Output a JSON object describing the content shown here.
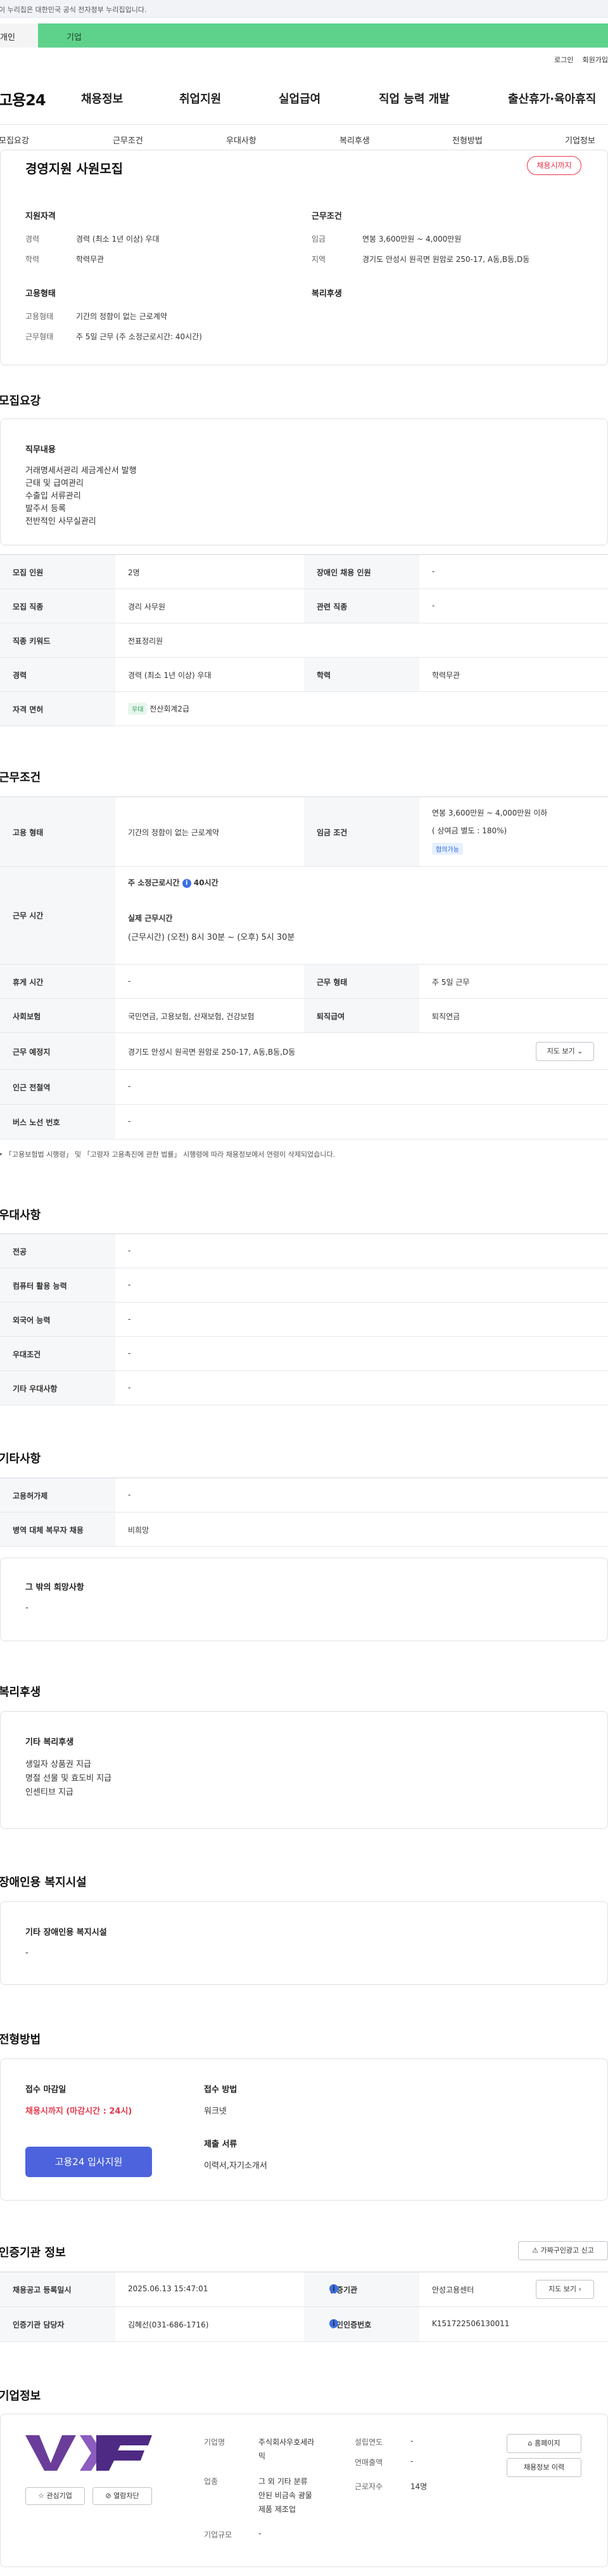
{
  "gov_banner": "이 누리집은 대한민국 공식 전자정부 누리집입니다.",
  "role_tabs": {
    "person": "개인",
    "corp": "기업"
  },
  "util": {
    "login": "로그인",
    "join": "회원가입"
  },
  "gnb": {
    "logo": "고용24",
    "items": [
      "채용정보",
      "취업지원",
      "실업급여",
      "직업 능력 개발",
      "출산휴가·육아휴직"
    ]
  },
  "subnav": [
    "모집요강",
    "근무조건",
    "우대사항",
    "복리후생",
    "전형방법",
    "기업정보"
  ],
  "job": {
    "title": "경영지원 사원모집",
    "status": "채용시까지",
    "summary": {
      "qual_head": "지원자격",
      "career_label": "경력",
      "career_value": "경력 (최소 1년 이상) 우대",
      "edu_label": "학력",
      "edu_value": "학력무관",
      "cond_head": "근무조건",
      "wage_label": "임금",
      "wage_value": "연봉 3,600만원 ~ 4,000만원",
      "region_label": "지역",
      "region_value": "경기도 안성시 원곡면 원암로 250-17, A동,B동,D동",
      "emp_head": "고용형태",
      "emp_label": "고용형태",
      "emp_value": "기간의 정함이 없는 근로계약",
      "work_label": "근무형태",
      "work_value": "주 5일 근무 (주 소정근로시간: 40시간)",
      "welfare_head": "복리후생"
    }
  },
  "recruit": {
    "title": "모집요강",
    "duty_head": "직무내용",
    "duties": [
      "거래명세서관리 세금계산서 발행",
      "근태 및 급여관리",
      "수출입 서류관리",
      "발주서 등록",
      "전반적인 사무실관리"
    ],
    "rows": [
      {
        "l1": "모집 인원",
        "v1": "2명",
        "l2": "장애인 채용 인원",
        "v2": "-"
      },
      {
        "l1": "모집 직종",
        "v1": "경리 사무원",
        "l2": "관련 직종",
        "v2": "-"
      },
      {
        "l1": "직종 키워드",
        "v1": "전표정리원"
      },
      {
        "l1": "경력",
        "v1": "경력 (최소 1년 이상) 우대",
        "l2": "학력",
        "v2": "학력무관"
      },
      {
        "l1": "자격 면허",
        "chip": "우대",
        "v1": "전산회계2급"
      }
    ]
  },
  "conditions": {
    "title": "근무조건",
    "emp_label": "고용 형태",
    "emp_value": "기간의 정함이 없는 근로계약",
    "wage_label": "임금 조건",
    "wage_value": "연봉 3,600만원 ~ 4,000만원 이하",
    "wage_bonus": "( 상여금 별도 : 180%)",
    "wage_chip": "협의가능",
    "hours_label": "근무 시간",
    "hours_week_label": "주 소정근로시간",
    "hours_week_value": "40시간",
    "hours_actual_label": "실제 근무시간",
    "hours_actual_value": "(근무시간) (오전) 8시 30분 ~ (오후) 5시 30분",
    "leave_label": "휴게 시간",
    "leave_value": "-",
    "form_label": "근무 형태",
    "form_value": "주 5일 근무",
    "ins_label": "사회보험",
    "ins_value": "국민연금, 고용보험, 산재보험, 건강보험",
    "ret_label": "퇴직급여",
    "ret_value": "퇴직연금",
    "place_label": "근무 예정지",
    "place_value": "경기도 안성시 원곡면 원암로 250-17, A동,B동,D동",
    "map_button": "지도 보기",
    "subway_label": "인근 전철역",
    "subway_value": "-",
    "bus_label": "버스 노선 번호",
    "bus_value": "-",
    "note": "「고용보험법 시행령」 및 「고령자 고용촉진에 관한 법률」 시행령에 따라 채용정보에서 연령이 삭제되었습니다."
  },
  "preference": {
    "title": "우대사항",
    "rows": [
      {
        "label": "전공",
        "value": "-"
      },
      {
        "label": "컴퓨터 활용 능력",
        "value": "-"
      },
      {
        "label": "외국어 능력",
        "value": "-"
      },
      {
        "label": "우대조건",
        "value": "-"
      },
      {
        "label": "기타 우대사항",
        "value": "-"
      }
    ]
  },
  "etc": {
    "title": "기타사항",
    "rows": [
      {
        "label": "고용허가제",
        "value": "-"
      },
      {
        "label": "병역 대체 복무자 채용",
        "value": "비희망"
      }
    ],
    "other_head": "그 밖의 희망사항",
    "other_value": "-"
  },
  "welfare": {
    "title": "복리후생",
    "head": "기타 복리후생",
    "items": [
      "생일자 상품권 지급",
      "명절 선물 및 효도비 지급",
      "인센티브 지급"
    ]
  },
  "disability": {
    "title": "장애인용 복지시설",
    "head": "기타 장애인용 복지시설",
    "value": "-"
  },
  "selection": {
    "title": "전형방법",
    "deadline_head": "접수 마감일",
    "deadline_value": "채용시까지 (마감시간 : 24시)",
    "method_head": "접수 방법",
    "method_value": "워크넷",
    "docs_head": "제출 서류",
    "docs_value": "이력서,자기소개서",
    "apply_button": "고용24 입사지원"
  },
  "cert": {
    "title": "인증기관 정보",
    "report_button": "가짜구인광고 신고",
    "reg_label": "채용공고 등록일시",
    "reg_value": "2025.06.13 15:47:01",
    "org_label": "인증기관",
    "org_value": "안성고용센터",
    "more_button": "지도 보기",
    "manager_label": "인증기관 담당자",
    "manager_value": "김혜선(031-686-1716)",
    "num_label": "구인인증번호",
    "num_value": "K151722506130011"
  },
  "company": {
    "title": "기업정보",
    "interest_button": "관심기업",
    "block_button": "열람차단",
    "name_label": "기업명",
    "name_value": [
      "주식회사우호세라",
      "믹"
    ],
    "industry_label": "업종",
    "industry_value": [
      "그 외 기타 분류",
      "안된 비금속 광물",
      "제품 제조업"
    ],
    "size_label": "기업규모",
    "size_value": "-",
    "founded_label": "설립연도",
    "founded_value": "-",
    "sales_label": "연매출액",
    "sales_value": "-",
    "staff_label": "근로자수",
    "staff_value": "14명",
    "home_button": "홈페이지",
    "list_button": "채용정보 이력"
  }
}
